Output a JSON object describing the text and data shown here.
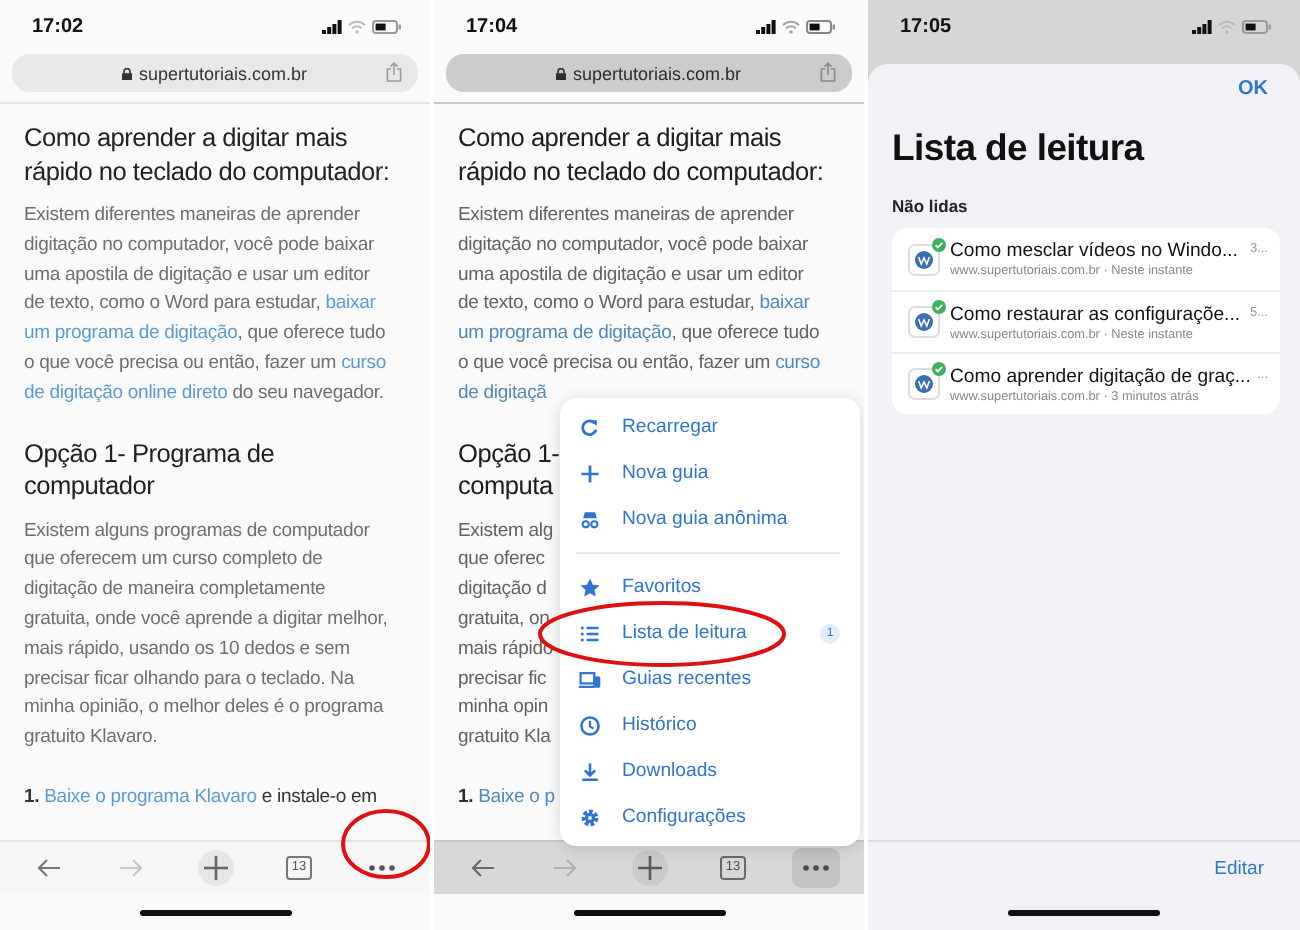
{
  "panels": [
    {
      "kind": "browser",
      "status_bar": {
        "time": "17:02"
      },
      "address_bar": {
        "url": "supertutoriais.com.br"
      },
      "dimmed": false,
      "article": [
        {
          "kind": "heading",
          "lines": [
            [
              {
                "text": "Como aprender a digitar mais",
                "link": false
              }
            ],
            [
              {
                "text": "rápido no teclado do computador:",
                "link": false
              }
            ]
          ]
        },
        {
          "kind": "paragraph",
          "lines": [
            [
              {
                "text": "Existem diferentes maneiras de aprender",
                "link": false
              }
            ],
            [
              {
                "text": "digitação no computador, você pode baixar",
                "link": false
              }
            ],
            [
              {
                "text": "uma apostila de digitação e usar um editor",
                "link": false
              }
            ],
            [
              {
                "text": "de texto, como o Word para estudar,",
                "link": false
              },
              {
                "text": "baixar",
                "link": true
              }
            ],
            [
              {
                "text": "um programa de digitação",
                "link": true
              },
              {
                "text": ", que oferece tudo",
                "link": false
              }
            ],
            [
              {
                "text": "o que você precisa ou então, fazer um",
                "link": false
              },
              {
                "text": "curso",
                "link": true
              }
            ],
            [
              {
                "text": "de digitação online direto",
                "link": true
              },
              {
                "text": "do seu navegador.",
                "link": false
              }
            ]
          ]
        },
        {
          "kind": "heading",
          "lines": [
            [
              {
                "text": "Opção 1- Programa de",
                "link": false
              }
            ],
            [
              {
                "text": "computador",
                "link": false
              }
            ]
          ]
        },
        {
          "kind": "paragraph",
          "lines": [
            [
              {
                "text": "Existem alguns programas de computador",
                "link": false
              }
            ],
            [
              {
                "text": "que oferecem um curso completo de",
                "link": false
              }
            ],
            [
              {
                "text": "digitação de maneira completamente",
                "link": false
              }
            ],
            [
              {
                "text": "gratuita, onde você aprende a digitar melhor,",
                "link": false
              }
            ],
            [
              {
                "text": "mais rápido, usando os 10 dedos e sem",
                "link": false
              }
            ],
            [
              {
                "text": "precisar ficar olhando para o teclado. Na",
                "link": false
              }
            ],
            [
              {
                "text": "minha opinião, o melhor deles é o programa",
                "link": false
              }
            ],
            [
              {
                "text": "gratuito Klavaro.",
                "link": false
              }
            ]
          ]
        },
        {
          "kind": "list_item",
          "lines": [
            [
              {
                "text": "**1.**",
                "link": false
              },
              {
                "text": "Baixe o programa Klavaro",
                "link": true
              },
              {
                "text": "e instale-o em",
                "link": false
              }
            ]
          ]
        }
      ],
      "toolbar": {
        "tab_count": "13",
        "forward_disabled": true,
        "more_pressed": false,
        "more_annotated": true
      }
    },
    {
      "kind": "browser",
      "status_bar": {
        "time": "17:04"
      },
      "address_bar": {
        "url": "supertutoriais.com.br"
      },
      "dimmed": true,
      "article": [
        {
          "kind": "heading",
          "lines": [
            [
              {
                "text": "Como aprender a digitar mais",
                "link": false
              }
            ],
            [
              {
                "text": "rápido no teclado do computador:",
                "link": false
              }
            ]
          ]
        },
        {
          "kind": "paragraph",
          "lines": [
            [
              {
                "text": "Existem diferentes maneiras de aprender",
                "link": false
              }
            ],
            [
              {
                "text": "digitação no computador, você pode baixar",
                "link": false
              }
            ],
            [
              {
                "text": "uma apostila de digitação e usar um editor",
                "link": false
              }
            ],
            [
              {
                "text": "de texto, como o Word para estudar,",
                "link": false
              },
              {
                "text": "baixar",
                "link": true
              }
            ],
            [
              {
                "text": "um programa de digitação",
                "link": true
              },
              {
                "text": ", que oferece tudo",
                "link": false
              }
            ],
            [
              {
                "text": "o que você precisa ou então, fazer um",
                "link": false
              },
              {
                "text": "curso",
                "link": true
              }
            ],
            [
              {
                "text": "de digitaçã",
                "link": true
              }
            ]
          ]
        },
        {
          "kind": "heading",
          "lines": [
            [
              {
                "text": "Opção 1-",
                "link": false
              }
            ],
            [
              {
                "text": "computa",
                "link": false
              }
            ]
          ]
        },
        {
          "kind": "paragraph",
          "lines": [
            [
              {
                "text": "Existem alg",
                "link": false
              }
            ],
            [
              {
                "text": "que oferec",
                "link": false
              }
            ],
            [
              {
                "text": "digitação d",
                "link": false
              }
            ],
            [
              {
                "text": "gratuita, on",
                "link": false
              }
            ],
            [
              {
                "text": "mais rápido",
                "link": false
              }
            ],
            [
              {
                "text": "precisar fic",
                "link": false
              }
            ],
            [
              {
                "text": "minha opin",
                "link": false
              }
            ],
            [
              {
                "text": "gratuito Kla",
                "link": false
              }
            ]
          ]
        },
        {
          "kind": "list_item",
          "lines": [
            [
              {
                "text": "**1.**",
                "link": false
              },
              {
                "text": "Baixe o p",
                "link": true
              }
            ]
          ]
        }
      ],
      "menu": {
        "sections": [
          [
            {
              "label": "Recarregar",
              "annotated": false
            },
            {
              "label": "Nova guia",
              "annotated": false
            },
            {
              "label": "Nova guia anônima",
              "annotated": false
            }
          ],
          [
            {
              "label": "Favoritos",
              "annotated": false
            },
            {
              "label": "Lista de leitura",
              "badge": "1",
              "annotated": true
            },
            {
              "label": "Guias recentes",
              "annotated": false
            },
            {
              "label": "Histórico",
              "annotated": false
            },
            {
              "label": "Downloads",
              "annotated": false
            },
            {
              "label": "Configurações",
              "annotated": false
            }
          ]
        ]
      },
      "toolbar": {
        "tab_count": "13",
        "forward_disabled": true,
        "more_pressed": true,
        "more_annotated": false
      }
    },
    {
      "kind": "reading_list",
      "status_bar": {
        "time": "17:05"
      },
      "done_button": "OK",
      "title": "Lista de leitura",
      "section": "Não lidas",
      "items": [
        {
          "title": "Como mesclar vídeos no Windo...",
          "subtitle": "www.supertutoriais.com.br · Neste instante",
          "trailing": "3...",
          "available_offline": true
        },
        {
          "title": "Como restaurar as configuraçõe...",
          "subtitle": "www.supertutoriais.com.br · Neste instante",
          "trailing": "5...",
          "available_offline": true
        },
        {
          "title": "Como aprender digitação de graç...",
          "subtitle": "www.supertutoriais.com.br · 3 minutos atrás",
          "trailing": "...",
          "available_offline": true
        }
      ],
      "edit_button": "Editar"
    }
  ]
}
